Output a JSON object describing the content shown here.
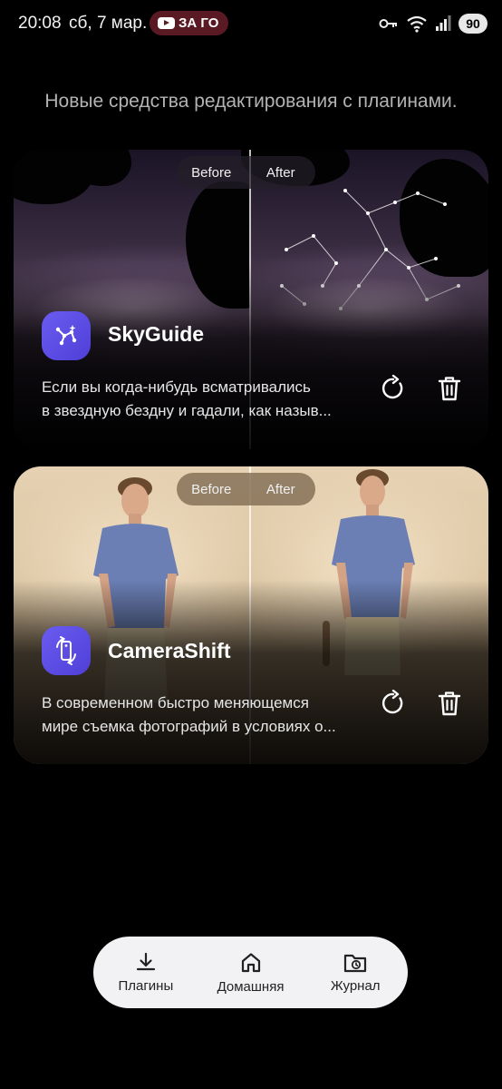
{
  "status_bar": {
    "time": "20:08",
    "date": "сб, 7 мар.",
    "notification_text": "ЗА ГО",
    "battery": "90",
    "icons": [
      "key-icon",
      "wifi-icon",
      "signal-icon",
      "battery-icon"
    ]
  },
  "headline": "Новые средства редактирования с плагинами.",
  "toggle": {
    "before": "Before",
    "after": "After"
  },
  "plugins": [
    {
      "name": "SkyGuide",
      "icon": "constellation-icon",
      "description_line1": "Если вы когда-нибудь всматривались",
      "description_line2": "в звездную бездну и гадали, как назыв..."
    },
    {
      "name": "CameraShift",
      "icon": "camera-rotate-icon",
      "description_line1": "В современном быстро меняющемся",
      "description_line2": "мире съемка фотографий в условиях о..."
    }
  ],
  "nav": {
    "plugins": "Плагины",
    "home": "Домашняя",
    "journal": "Журнал"
  },
  "colors": {
    "accent": "#5b4de6",
    "nav_bg": "#f2f2f4",
    "background": "#000000"
  }
}
